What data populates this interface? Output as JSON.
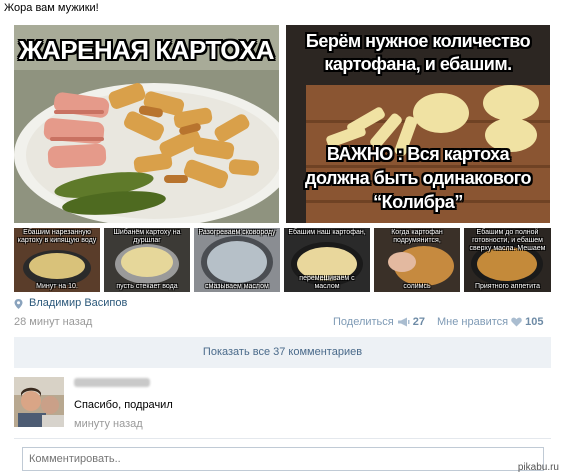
{
  "post": {
    "text": "Жора вам мужики!",
    "photos": {
      "left_caption": "ЖАРЕНАЯ КАРТОХА",
      "right_caption_top_1": "Берём нужное количество",
      "right_caption_top_2": "картофана, и ебашим.",
      "right_caption_bottom_1": "ВАЖНО : Вся картоха",
      "right_caption_bottom_2": "должна быть одинакового",
      "right_caption_bottom_3": "“Колибра”"
    },
    "thumbs": [
      {
        "top": "Ебашим нарезанную картоху в кипящую воду",
        "bottom": "Минут на 10."
      },
      {
        "top": "Шибанём картоху на дуршлаг",
        "bottom": "пусть стекает вода"
      },
      {
        "top": "Разогреваем сковороду",
        "bottom": "смазываем маслом"
      },
      {
        "top": "Ебашим наш картофан,",
        "bottom": "перемешиваем с маслом"
      },
      {
        "top": "Когда картофан подрумянится,",
        "bottom": "солимсь"
      },
      {
        "top": "Ебашим до полной готовности, и ебашем сверху масла. Мешаем",
        "bottom": "Приятного аппетита"
      }
    ],
    "author": "Владимир Васипов",
    "time": "28 минут назад",
    "share_label": "Поделиться",
    "share_count": "27",
    "like_label": "Мне нравится",
    "like_count": "105"
  },
  "comments": {
    "show_all_label": "Показать все 37 комментариев",
    "items": [
      {
        "text": "Спасибо, подрачил",
        "time": "минуту назад"
      }
    ],
    "input_placeholder": "Комментировать.."
  },
  "watermark": "pikabu.ru",
  "colors": {
    "link": "#2b587a",
    "muted": "#999999",
    "button_bg": "#edf1f5"
  }
}
